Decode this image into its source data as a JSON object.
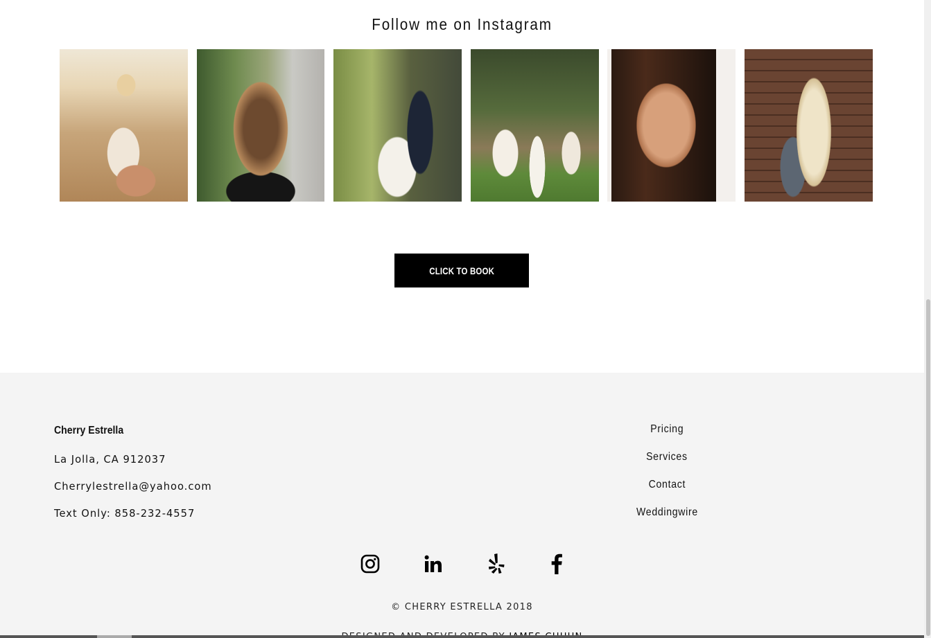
{
  "instagram": {
    "heading": "Follow me on Instagram",
    "photos": [
      {
        "alt": "instagram-photo-1"
      },
      {
        "alt": "instagram-photo-2"
      },
      {
        "alt": "instagram-photo-3"
      },
      {
        "alt": "instagram-photo-4"
      },
      {
        "alt": "instagram-photo-5"
      },
      {
        "alt": "instagram-photo-6"
      }
    ]
  },
  "cta": {
    "book_label": "CLICK TO BOOK"
  },
  "footer": {
    "name": "Cherry Estrella",
    "address": "La Jolla, CA 912037",
    "email": "Cherrylestrella@yahoo.com",
    "phone": "Text Only: 858-232-4557",
    "nav": [
      "Pricing",
      "Services",
      "Contact",
      "Weddingwire"
    ],
    "social": [
      "instagram-icon",
      "linkedin-icon",
      "yelp-icon",
      "facebook-icon"
    ],
    "copyright": "© CHERRY ESTRELLA 2018",
    "designed_prefix": "DESIGNED AND DEVELOPED BY",
    "designed_name": "JAMES CHUUN"
  },
  "colors": {
    "button_bg": "#000000",
    "footer_bg": "#f4f4f4",
    "text": "#111111"
  }
}
